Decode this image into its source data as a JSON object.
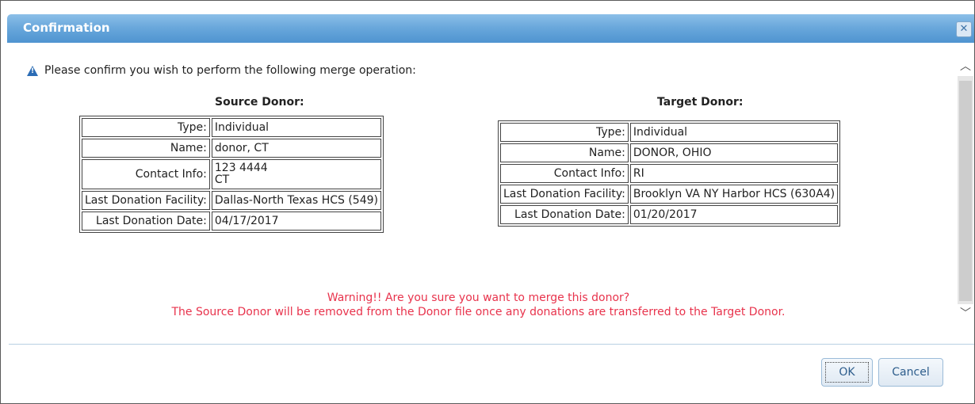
{
  "dialog": {
    "title": "Confirmation",
    "close_icon": "close-icon",
    "message": "Please confirm you wish to perform the following merge operation:",
    "warning_icon": "warning-triangle-icon"
  },
  "source": {
    "heading": "Source Donor:",
    "rows": [
      {
        "label": "Type:",
        "value": "Individual"
      },
      {
        "label": "Name:",
        "value": "donor, CT"
      },
      {
        "label": "Contact Info:",
        "value": "123 4444\nCT"
      },
      {
        "label": "Last Donation Facility:",
        "value": "Dallas-North Texas HCS (549)"
      },
      {
        "label": "Last Donation Date:",
        "value": "04/17/2017"
      }
    ]
  },
  "target": {
    "heading": "Target Donor:",
    "rows": [
      {
        "label": "Type:",
        "value": "Individual"
      },
      {
        "label": "Name:",
        "value": "DONOR, OHIO"
      },
      {
        "label": "Contact Info:",
        "value": "RI"
      },
      {
        "label": "Last Donation Facility:",
        "value": "Brooklyn VA NY Harbor HCS (630A4)"
      },
      {
        "label": "Last Donation Date:",
        "value": "01/20/2017"
      }
    ]
  },
  "warning": {
    "line1": "Warning!! Are you sure you want to merge this donor?",
    "line2": "The Source Donor will be removed from the Donor file once any donations are transferred to the Target Donor."
  },
  "buttons": {
    "ok_label": "OK",
    "cancel_label": "Cancel"
  },
  "colors": {
    "title_bar": "#6aa8dc",
    "warning_text": "#e8334c",
    "warning_icon": "#2b6cb5"
  }
}
